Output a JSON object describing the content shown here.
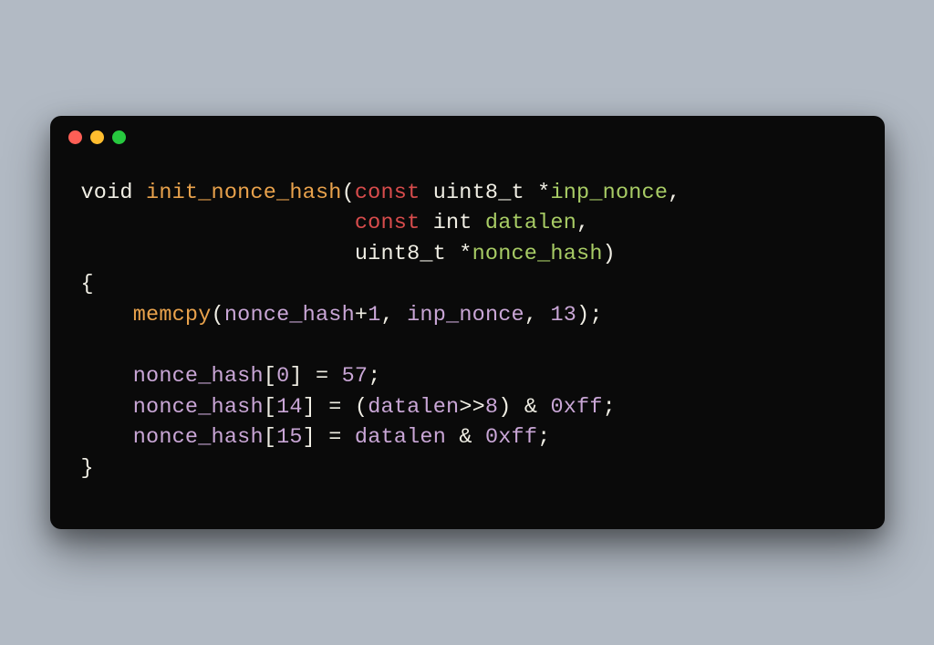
{
  "code": {
    "l1": {
      "void": "void ",
      "fn": "init_nonce_hash",
      "lp": "(",
      "const": "const ",
      "type": "uint8_t ",
      "star": "*",
      "param": "inp_nonce",
      "comma": ","
    },
    "l2": {
      "indent": "                     ",
      "const": "const ",
      "type": "int ",
      "param": "datalen",
      "comma": ","
    },
    "l3": {
      "indent": "                     ",
      "type": "uint8_t ",
      "star": "*",
      "param": "nonce_hash",
      "rp": ")"
    },
    "l4": {
      "brace": "{"
    },
    "l5": {
      "indent": "    ",
      "fn": "memcpy",
      "lp": "(",
      "arg1": "nonce_hash",
      "plus": "+",
      "one": "1",
      "c1": ", ",
      "arg2": "inp_nonce",
      "c2": ", ",
      "thirteen": "13",
      "rp": ");"
    },
    "l6": {
      "blank": ""
    },
    "l7": {
      "indent": "    ",
      "ident": "nonce_hash",
      "lb": "[",
      "idx": "0",
      "rb": "] = ",
      "val": "57",
      "semi": ";"
    },
    "l8": {
      "indent": "    ",
      "ident": "nonce_hash",
      "lb": "[",
      "idx": "14",
      "rb": "] = (",
      "dlen": "datalen",
      "shift": ">>",
      "eight": "8",
      "close": ") & ",
      "hex": "0xff",
      "semi": ";"
    },
    "l9": {
      "indent": "    ",
      "ident": "nonce_hash",
      "lb": "[",
      "idx": "15",
      "rb": "] = ",
      "dlen": "datalen",
      "amp": " & ",
      "hex": "0xff",
      "semi": ";"
    },
    "l10": {
      "brace": "}"
    }
  }
}
